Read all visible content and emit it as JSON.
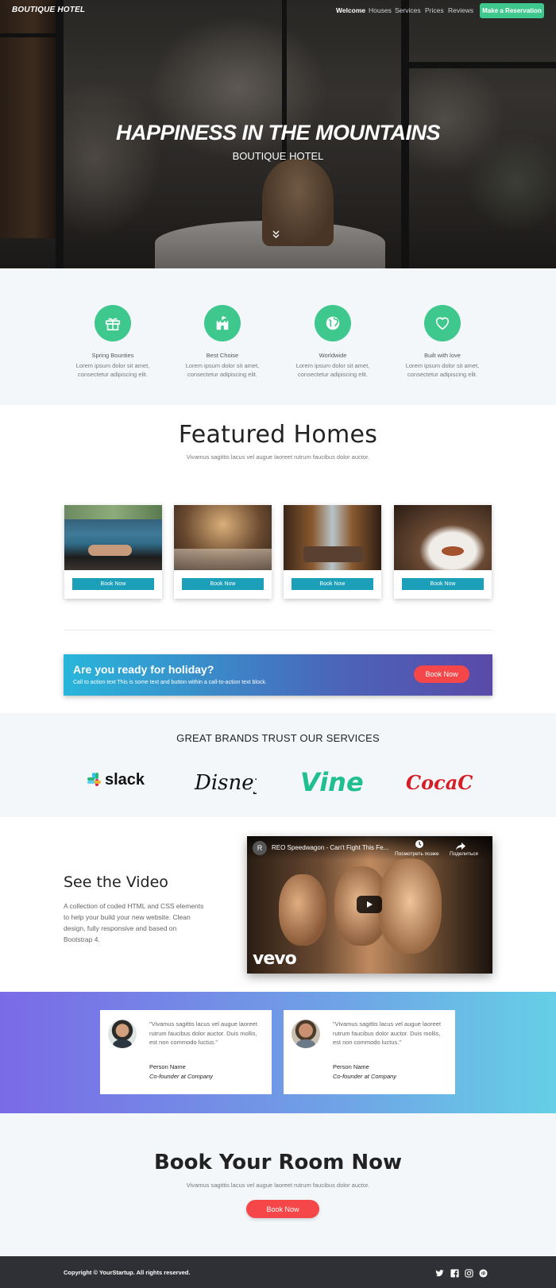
{
  "header": {
    "brand": "BOUTIQUE HOTEL",
    "nav": [
      "Welcome",
      "Houses",
      "Services",
      "Prices",
      "Reviews"
    ],
    "cta": "Make a Reservation"
  },
  "hero": {
    "title": "HAPPINESS IN THE MOUNTAINS",
    "subtitle": "BOUTIQUE HOTEL",
    "scroll_icon": "double-chevron-down-icon"
  },
  "features": [
    {
      "icon": "gift-icon",
      "title": "Spring Bounties",
      "text1": "Lorem ipsum dolor sit amet,",
      "text2": "consectetur adipiscing elit."
    },
    {
      "icon": "castle-icon",
      "title": "Best Choise",
      "text1": "Lorem ipsum dolor sit amet,",
      "text2": "consectetur adipiscing elit."
    },
    {
      "icon": "globe-icon",
      "title": "Worldwide",
      "text1": "Lorem ipsum dolor sit amet,",
      "text2": "consectetur adipiscing elit."
    },
    {
      "icon": "heart-icon",
      "title": "Built with love",
      "text1": "Lorem ipsum dolor sit amet,",
      "text2": "consectetur adipiscing elit."
    }
  ],
  "featured": {
    "title": "Featured Homes",
    "subtitle": "Vivamus sagittis lacus vel augue laoreet rutrum faucibus dolor auctor.",
    "cards": [
      {
        "button": "Book Now"
      },
      {
        "button": "Book Now"
      },
      {
        "button": "Book Now"
      },
      {
        "button": "Book Now"
      }
    ]
  },
  "cta": {
    "title": "Are you ready for holiday?",
    "text": "Call to action text This is some text and button within a call-to-action text block.",
    "button": "Book Now"
  },
  "brands": {
    "title": "GREAT BRANDS TRUST OUR SERVICES",
    "logos": [
      "slack",
      "Disney",
      "Vine",
      "Coca-Cola"
    ]
  },
  "video": {
    "title": "See the Video",
    "text": "A collection of coded HTML and CSS elements to help your build your new website. Clean design, fully responsive and based on Bootstrap 4.",
    "embed_title": "REO Speedwagon - Can't Fight This Fe...",
    "channel_initial": "R",
    "watch_later": "Посмотреть позже",
    "share": "Поделиться",
    "logo": "vevo"
  },
  "testimonials": [
    {
      "quote": "\"Vivamus sagittis lacus vel augue laoreet rutrum faucibus dolor auctor. Duis mollis, est non commodo luctus.\"",
      "name": "Person Name",
      "role": "Co-founder at Company"
    },
    {
      "quote": "\"Vivamus sagittis lacus vel augue laoreet rutrum faucibus dolor auctor. Duis mollis, est non commodo luctus.\"",
      "name": "Person Name",
      "role": "Co-founder at Company"
    }
  ],
  "book": {
    "title": "Book Your Room Now",
    "subtitle": "Vivamus sagittis lacus vel augue laoreet rutrum faucibus dolor auctor.",
    "button": "Book Now"
  },
  "footer": {
    "copyright": "Copyright © YourStartup. All rights reserved.",
    "social": [
      "twitter-icon",
      "facebook-icon",
      "instagram-icon",
      "pinterest-icon"
    ]
  },
  "colors": {
    "accent_green": "#3fc88e",
    "button_teal": "#1c9fb8",
    "button_red": "#f5474a",
    "footer_dark": "#2e3035"
  }
}
